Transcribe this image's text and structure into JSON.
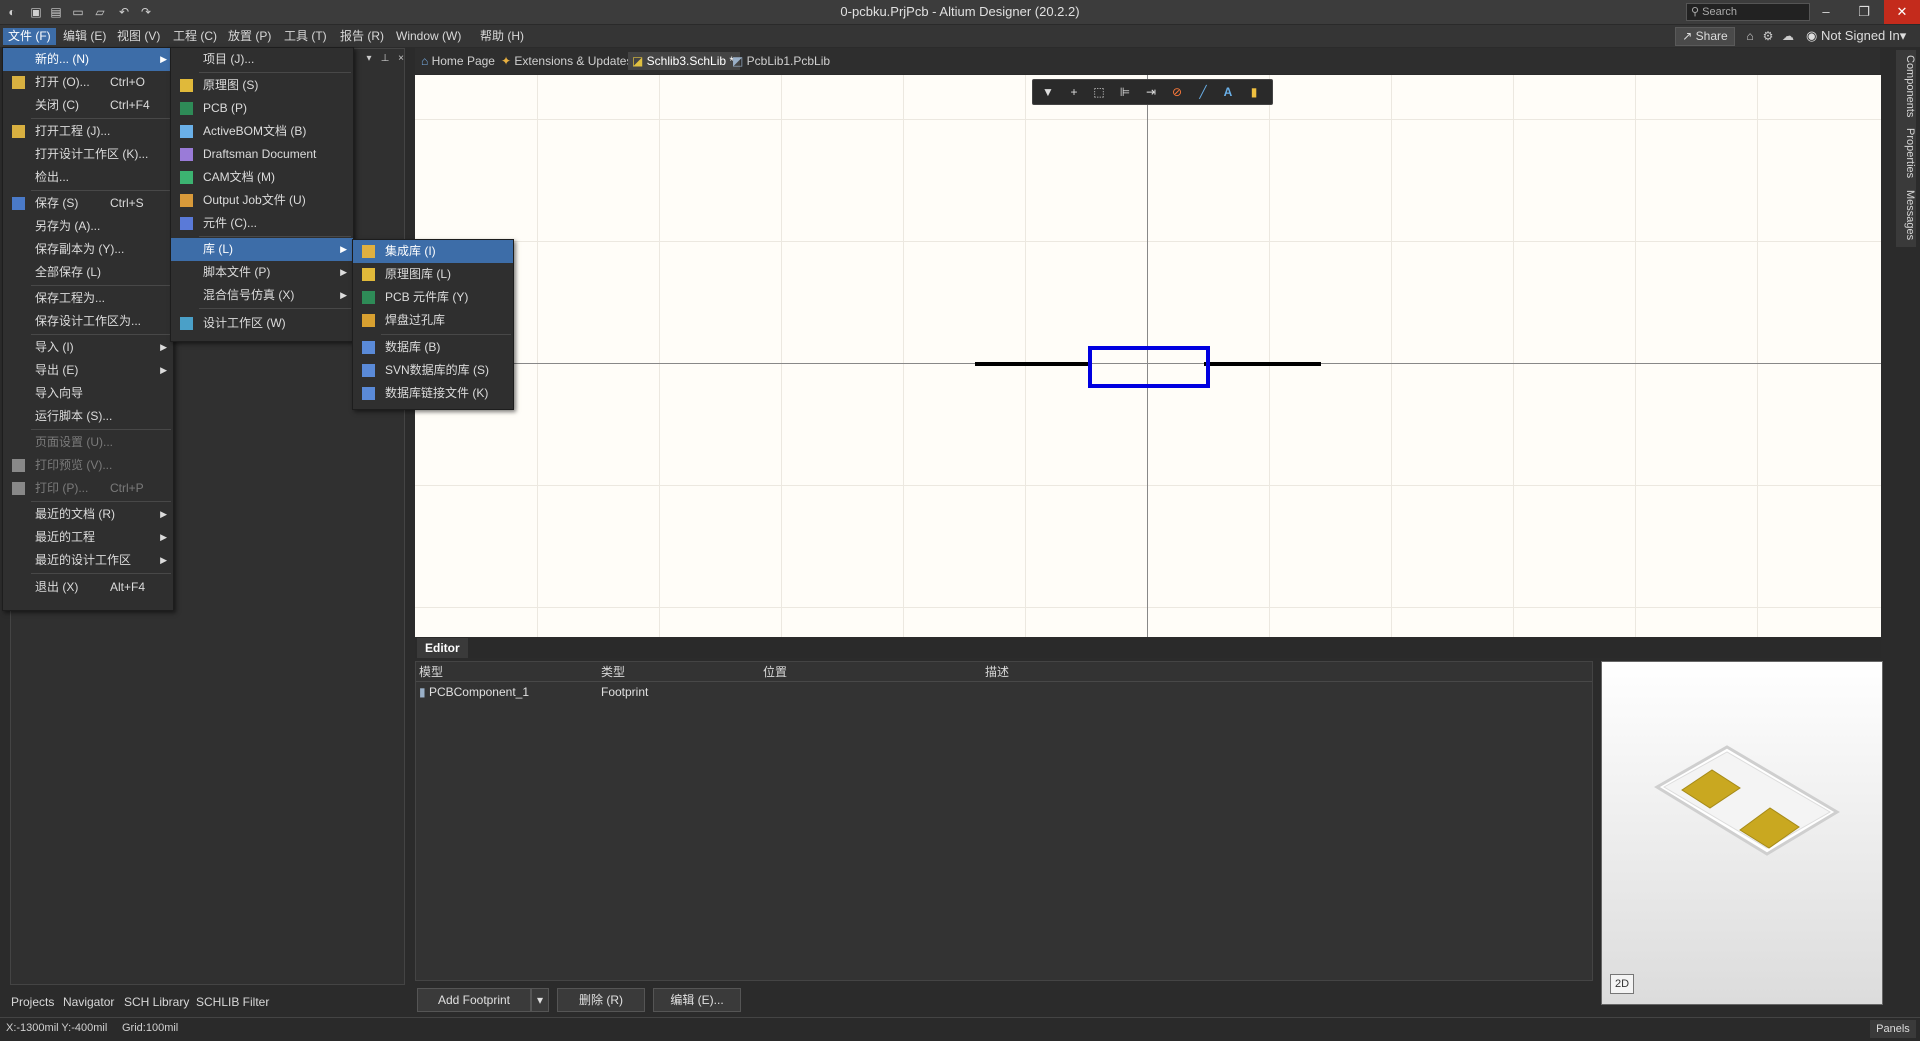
{
  "window": {
    "title": "0-pcbku.PrjPcb - Altium Designer (20.2.2)",
    "search_placeholder": "Search",
    "minimize": "–",
    "restore": "❐",
    "close": "✕"
  },
  "menubar": {
    "items": [
      "文件 (F)",
      "编辑 (E)",
      "视图 (V)",
      "工程 (C)",
      "放置 (P)",
      "工具 (T)",
      "报告 (R)",
      "Window (W)",
      "帮助 (H)"
    ],
    "share": "Share",
    "user": "Not Signed In"
  },
  "doc_tabs": [
    {
      "label": "Home Page"
    },
    {
      "label": "Extensions & Updates"
    },
    {
      "label": "Schlib3.SchLib *"
    },
    {
      "label": "PcbLib1.PcbLib"
    }
  ],
  "file_menu": [
    {
      "label": "新的... (N)",
      "shortcut": "",
      "submenu": true,
      "highlighted": true
    },
    {
      "label": "打开 (O)...",
      "shortcut": "Ctrl+O"
    },
    {
      "label": "关闭 (C)",
      "shortcut": "Ctrl+F4"
    },
    {
      "label": "打开工程 (J)..."
    },
    {
      "label": "打开设计工作区 (K)..."
    },
    {
      "label": "检出..."
    },
    {
      "label": "保存 (S)",
      "shortcut": "Ctrl+S"
    },
    {
      "label": "另存为 (A)..."
    },
    {
      "label": "保存副本为 (Y)..."
    },
    {
      "label": "全部保存 (L)"
    },
    {
      "label": "保存工程为..."
    },
    {
      "label": "保存设计工作区为..."
    },
    {
      "label": "导入 (I)",
      "submenu": true
    },
    {
      "label": "导出 (E)",
      "submenu": true
    },
    {
      "label": "导入向导"
    },
    {
      "label": "运行脚本 (S)..."
    },
    {
      "label": "页面设置 (U)...",
      "disabled": true
    },
    {
      "label": "打印预览 (V)...",
      "disabled": true
    },
    {
      "label": "打印 (P)...",
      "shortcut": "Ctrl+P",
      "disabled": true
    },
    {
      "label": "最近的文档 (R)",
      "submenu": true
    },
    {
      "label": "最近的工程",
      "submenu": true
    },
    {
      "label": "最近的设计工作区",
      "submenu": true
    },
    {
      "label": "退出 (X)",
      "shortcut": "Alt+F4"
    }
  ],
  "new_menu": [
    {
      "label": "项目 (J)..."
    },
    {
      "label": "原理图 (S)"
    },
    {
      "label": "PCB (P)"
    },
    {
      "label": "ActiveBOM文档 (B)"
    },
    {
      "label": "Draftsman Document"
    },
    {
      "label": "CAM文档 (M)"
    },
    {
      "label": "Output Job文件 (U)"
    },
    {
      "label": "元件 (C)..."
    },
    {
      "label": "库 (L)",
      "submenu": true,
      "highlighted": true
    },
    {
      "label": "脚本文件 (P)",
      "submenu": true
    },
    {
      "label": "混合信号仿真 (X)",
      "submenu": true
    },
    {
      "label": "设计工作区 (W)"
    }
  ],
  "lib_menu": [
    {
      "label": "集成库 (I)",
      "highlighted": true
    },
    {
      "label": "原理图库 (L)"
    },
    {
      "label": "PCB 元件库 (Y)"
    },
    {
      "label": "焊盘过孔库"
    },
    {
      "label": "数据库 (B)"
    },
    {
      "label": "SVN数据库的库 (S)"
    },
    {
      "label": "数据库链接文件 (K)"
    }
  ],
  "right_tabs": [
    "Components",
    "Properties",
    "Messages"
  ],
  "editor": {
    "tab": "Editor",
    "columns": [
      "模型",
      "类型",
      "位置",
      "描述"
    ],
    "rows": [
      {
        "model": "PCBComponent_1",
        "type": "Footprint",
        "location": "",
        "description": ""
      }
    ],
    "buttons": {
      "add": "Add Footprint",
      "delete": "删除 (R)",
      "edit": "编辑 (E)..."
    },
    "preview_mode": "2D"
  },
  "left_tabs": [
    "Projects",
    "Navigator",
    "SCH Library",
    "SCHLIB Filter"
  ],
  "status": {
    "coords": "X:-1300mil Y:-400mil",
    "grid": "Grid:100mil",
    "panels": "Panels"
  }
}
